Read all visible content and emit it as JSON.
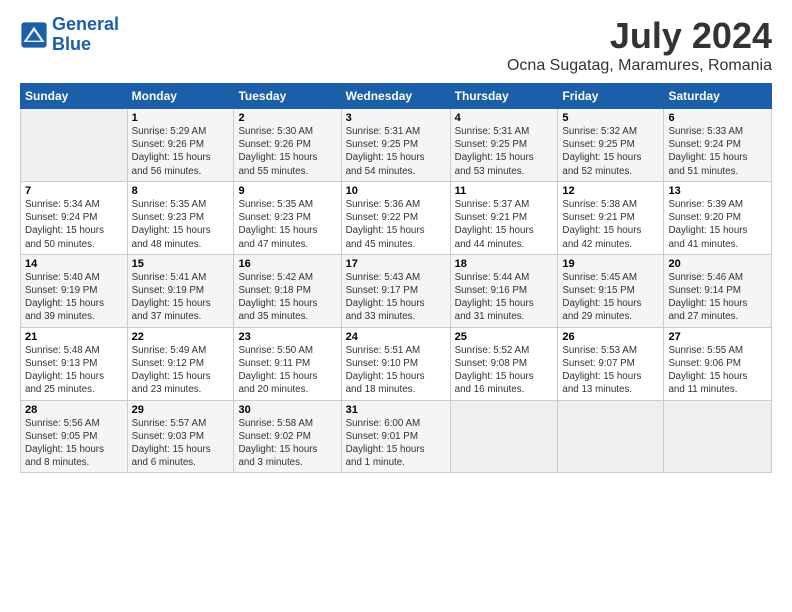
{
  "logo": {
    "line1": "General",
    "line2": "Blue"
  },
  "title": "July 2024",
  "subtitle": "Ocna Sugatag, Maramures, Romania",
  "days_of_week": [
    "Sunday",
    "Monday",
    "Tuesday",
    "Wednesday",
    "Thursday",
    "Friday",
    "Saturday"
  ],
  "weeks": [
    [
      {
        "num": "",
        "info": ""
      },
      {
        "num": "1",
        "info": "Sunrise: 5:29 AM\nSunset: 9:26 PM\nDaylight: 15 hours\nand 56 minutes."
      },
      {
        "num": "2",
        "info": "Sunrise: 5:30 AM\nSunset: 9:26 PM\nDaylight: 15 hours\nand 55 minutes."
      },
      {
        "num": "3",
        "info": "Sunrise: 5:31 AM\nSunset: 9:25 PM\nDaylight: 15 hours\nand 54 minutes."
      },
      {
        "num": "4",
        "info": "Sunrise: 5:31 AM\nSunset: 9:25 PM\nDaylight: 15 hours\nand 53 minutes."
      },
      {
        "num": "5",
        "info": "Sunrise: 5:32 AM\nSunset: 9:25 PM\nDaylight: 15 hours\nand 52 minutes."
      },
      {
        "num": "6",
        "info": "Sunrise: 5:33 AM\nSunset: 9:24 PM\nDaylight: 15 hours\nand 51 minutes."
      }
    ],
    [
      {
        "num": "7",
        "info": "Sunrise: 5:34 AM\nSunset: 9:24 PM\nDaylight: 15 hours\nand 50 minutes."
      },
      {
        "num": "8",
        "info": "Sunrise: 5:35 AM\nSunset: 9:23 PM\nDaylight: 15 hours\nand 48 minutes."
      },
      {
        "num": "9",
        "info": "Sunrise: 5:35 AM\nSunset: 9:23 PM\nDaylight: 15 hours\nand 47 minutes."
      },
      {
        "num": "10",
        "info": "Sunrise: 5:36 AM\nSunset: 9:22 PM\nDaylight: 15 hours\nand 45 minutes."
      },
      {
        "num": "11",
        "info": "Sunrise: 5:37 AM\nSunset: 9:21 PM\nDaylight: 15 hours\nand 44 minutes."
      },
      {
        "num": "12",
        "info": "Sunrise: 5:38 AM\nSunset: 9:21 PM\nDaylight: 15 hours\nand 42 minutes."
      },
      {
        "num": "13",
        "info": "Sunrise: 5:39 AM\nSunset: 9:20 PM\nDaylight: 15 hours\nand 41 minutes."
      }
    ],
    [
      {
        "num": "14",
        "info": "Sunrise: 5:40 AM\nSunset: 9:19 PM\nDaylight: 15 hours\nand 39 minutes."
      },
      {
        "num": "15",
        "info": "Sunrise: 5:41 AM\nSunset: 9:19 PM\nDaylight: 15 hours\nand 37 minutes."
      },
      {
        "num": "16",
        "info": "Sunrise: 5:42 AM\nSunset: 9:18 PM\nDaylight: 15 hours\nand 35 minutes."
      },
      {
        "num": "17",
        "info": "Sunrise: 5:43 AM\nSunset: 9:17 PM\nDaylight: 15 hours\nand 33 minutes."
      },
      {
        "num": "18",
        "info": "Sunrise: 5:44 AM\nSunset: 9:16 PM\nDaylight: 15 hours\nand 31 minutes."
      },
      {
        "num": "19",
        "info": "Sunrise: 5:45 AM\nSunset: 9:15 PM\nDaylight: 15 hours\nand 29 minutes."
      },
      {
        "num": "20",
        "info": "Sunrise: 5:46 AM\nSunset: 9:14 PM\nDaylight: 15 hours\nand 27 minutes."
      }
    ],
    [
      {
        "num": "21",
        "info": "Sunrise: 5:48 AM\nSunset: 9:13 PM\nDaylight: 15 hours\nand 25 minutes."
      },
      {
        "num": "22",
        "info": "Sunrise: 5:49 AM\nSunset: 9:12 PM\nDaylight: 15 hours\nand 23 minutes."
      },
      {
        "num": "23",
        "info": "Sunrise: 5:50 AM\nSunset: 9:11 PM\nDaylight: 15 hours\nand 20 minutes."
      },
      {
        "num": "24",
        "info": "Sunrise: 5:51 AM\nSunset: 9:10 PM\nDaylight: 15 hours\nand 18 minutes."
      },
      {
        "num": "25",
        "info": "Sunrise: 5:52 AM\nSunset: 9:08 PM\nDaylight: 15 hours\nand 16 minutes."
      },
      {
        "num": "26",
        "info": "Sunrise: 5:53 AM\nSunset: 9:07 PM\nDaylight: 15 hours\nand 13 minutes."
      },
      {
        "num": "27",
        "info": "Sunrise: 5:55 AM\nSunset: 9:06 PM\nDaylight: 15 hours\nand 11 minutes."
      }
    ],
    [
      {
        "num": "28",
        "info": "Sunrise: 5:56 AM\nSunset: 9:05 PM\nDaylight: 15 hours\nand 8 minutes."
      },
      {
        "num": "29",
        "info": "Sunrise: 5:57 AM\nSunset: 9:03 PM\nDaylight: 15 hours\nand 6 minutes."
      },
      {
        "num": "30",
        "info": "Sunrise: 5:58 AM\nSunset: 9:02 PM\nDaylight: 15 hours\nand 3 minutes."
      },
      {
        "num": "31",
        "info": "Sunrise: 6:00 AM\nSunset: 9:01 PM\nDaylight: 15 hours\nand 1 minute."
      },
      {
        "num": "",
        "info": ""
      },
      {
        "num": "",
        "info": ""
      },
      {
        "num": "",
        "info": ""
      }
    ]
  ]
}
